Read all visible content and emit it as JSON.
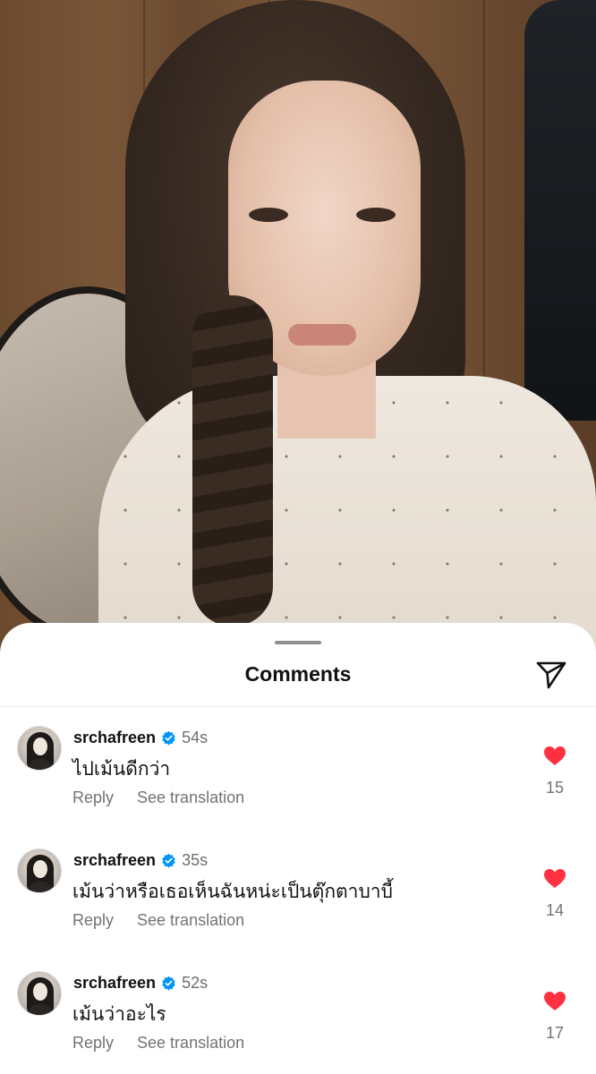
{
  "sheet": {
    "title": "Comments"
  },
  "comments": [
    {
      "username": "srchafreen",
      "time": "54s",
      "text": "ไปเม้นดีกว่า",
      "reply_label": "Reply",
      "translate_label": "See translation",
      "likes": "15",
      "liked": true
    },
    {
      "username": "srchafreen",
      "time": "35s",
      "text": "เม้นว่าหรือเธอเห็นฉันหน่ะเป็นตุ๊กตาบาบี้",
      "reply_label": "Reply",
      "translate_label": "See translation",
      "likes": "14",
      "liked": true
    },
    {
      "username": "srchafreen",
      "time": "52s",
      "text": "เม้นว่าอะไร",
      "reply_label": "Reply",
      "translate_label": "See translation",
      "likes": "17",
      "liked": true
    }
  ],
  "colors": {
    "heart": "#ff3040",
    "verified": "#0095f6",
    "secondary_text": "#737373"
  },
  "icons": {
    "share": "paper-plane-icon",
    "like": "heart-icon",
    "verified": "verified-badge-icon"
  }
}
